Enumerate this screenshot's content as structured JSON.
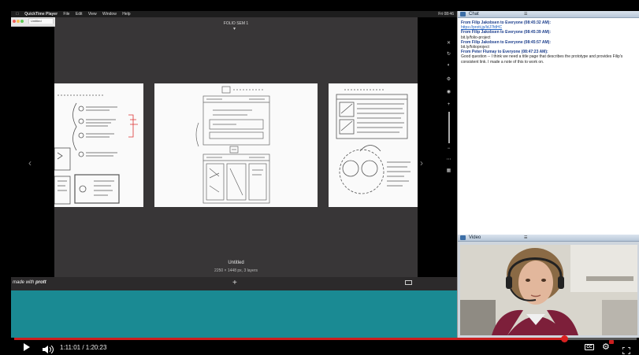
{
  "menubar": {
    "app_name": "QuickTime Player",
    "items": [
      "File",
      "Edit",
      "View",
      "Window",
      "Help"
    ],
    "clock": "Fri 08:46"
  },
  "browser": {
    "tab_label": "Untitled",
    "back_label": "Back"
  },
  "board": {
    "title": "FOLIO SEM 1",
    "prototype_title": "Untitled",
    "prototype_meta": "2250 × 1448 px, 3 layers"
  },
  "made_with": {
    "prefix": "made with ",
    "brand": "prott"
  },
  "chat": {
    "title": "Chat",
    "menu_label": "☰",
    "messages": [
      {
        "from": "From Filip Jakobsen to Everyone (08:45:32 AM):",
        "text": "https://prott.jp/ldJ7fdHC",
        "link": true
      },
      {
        "from": "From Filip Jakobsen to Everyone (08:45:39 AM):",
        "text": "bit.ly/folio-project",
        "link": false
      },
      {
        "from": "From Filip Jakobsen to Everyone (08:45:57 AM):",
        "text": "bit.ly/folioproject",
        "link": false
      },
      {
        "from": "From Peter Flumay to Everyone (08:47:23 AM):",
        "text": "Good question -- I think we need a title page that describes the prototype and provides Filip's consistent link. I made a note of this to work on.",
        "link": false
      }
    ]
  },
  "video": {
    "title": "Video",
    "menu_label": "☰"
  },
  "player": {
    "time": "1:11:01 / 1:20:23",
    "progress": 0.883,
    "cc_label": "CC"
  },
  "colors": {
    "teal": "#1a8a93",
    "canvas": "#2c2a2b",
    "progress": "#cc1f1f",
    "chat_from": "#1c3e8c"
  }
}
